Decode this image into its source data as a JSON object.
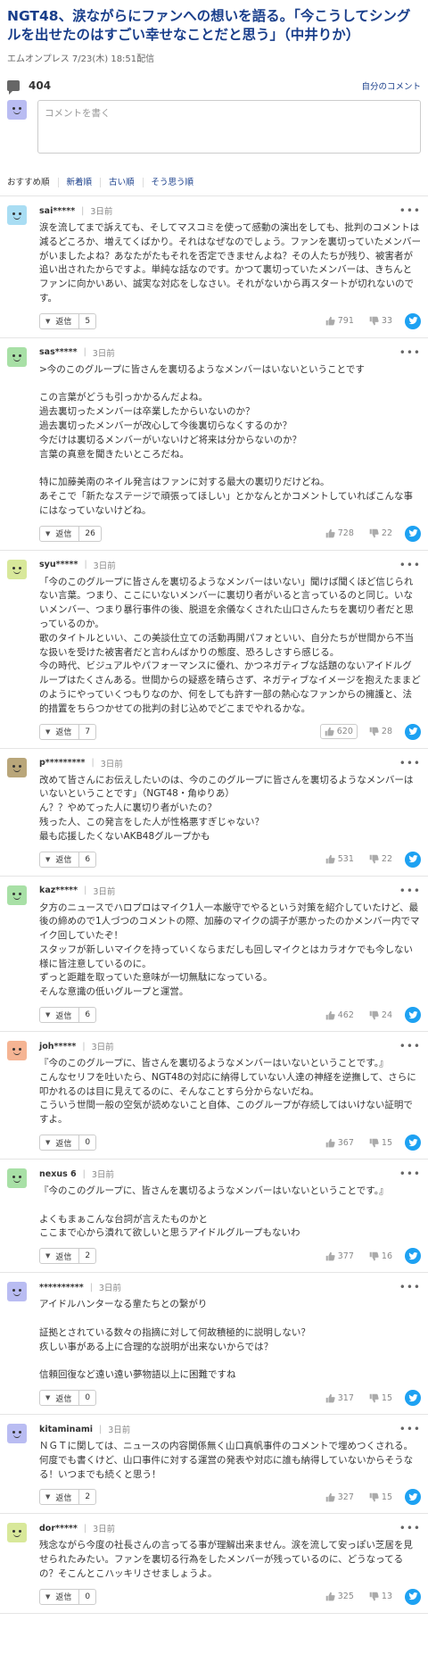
{
  "article": {
    "title": "NGT48、涙ながらにファンへの想いを語る。「今こうしてシングルを出せたのはすごい幸せなことだと思う」（中井りか）",
    "source": "エムオンプレス",
    "date": "7/23(木) 18:51配信"
  },
  "comments_header": {
    "count": "404",
    "own_comments": "自分のコメント",
    "icon": "speech-bubble-icon"
  },
  "comment_input": {
    "placeholder": "コメントを書く"
  },
  "sort_tabs": [
    "おすすめ順",
    "新着順",
    "古い順",
    "そう思う順"
  ],
  "reply_label": "返信",
  "comments": [
    {
      "user": "sai*****",
      "time": "3日前",
      "avatar_color": "#a9ddf3",
      "lines": [
        "涙を流してまで訴えても、そしてマスコミを使って感動の演出をしても、批判のコメントは減るどころか、増えてくばかり。それはなぜなのでしょう。ファンを裏切っていたメンバーがいましたよね？あなたがたもそれを否定できませんよね？その人たちが残り、被害者が追い出されたからですよ。単純な話なのです。かつて裏切っていたメンバーは、きちんとファンに向かいあい、誠実な対応をしなさい。それがないから再スタートが切れないのです。"
      ],
      "replies": "5",
      "up": "791",
      "down": "33",
      "voted": false
    },
    {
      "user": "sas*****",
      "time": "3日前",
      "avatar_color": "#a8e0a6",
      "lines": [
        ">今のこのグループに皆さんを裏切るようなメンバーはいないということです",
        "",
        "この言葉がどうも引っかかるんだよね。",
        "過去裏切ったメンバーは卒業したからいないのか？",
        "過去裏切ったメンバーが改心して今後裏切らなくするのか？",
        "今だけは裏切るメンバーがいないけど将来は分からないのか？",
        "言葉の真意を聞きたいところだね。",
        "",
        "特に加藤美南のネイル発言はファンに対する最大の裏切りだけどね。",
        "あそこで「新たなステージで頑張ってほしい」とかなんとかコメントしていればこんな事にはなっていないけどね。"
      ],
      "replies": "26",
      "up": "728",
      "down": "22",
      "voted": false
    },
    {
      "user": "syu*****",
      "time": "3日前",
      "avatar_color": "#d8e89a",
      "lines": [
        "「今のこのグループに皆さんを裏切るようなメンバーはいない」聞けば聞くほど信じられない言葉。つまり、ここにいないメンバーに裏切り者がいると言っているのと同じ。いないメンバー、つまり暴行事件の後、脱退を余儀なくされた山口さんたちを裏切り者だと思っているのか。",
        "歌のタイトルといい、この美談仕立ての活動再開パフォといい、自分たちが世間から不当な扱いを受けた被害者だと言わんばかりの態度、恐ろしさすら感じる。",
        "今の時代、ビジュアルやパフォーマンスに優れ、かつネガティブな話題のないアイドルグループはたくさんある。世間からの疑惑を晴らさず、ネガティブなイメージを抱えたままどのようにやっていくつもりなのか、何をしても許す一部の熱心なファンからの擁護と、法的措置をちらつかせての批判の封じ込めでどこまでやれるかな。"
      ],
      "replies": "7",
      "up": "620",
      "down": "28",
      "voted": true
    },
    {
      "user": "p*********",
      "time": "3日前",
      "avatar_color": "#b9a67a",
      "lines": [
        "改めて皆さんにお伝えしたいのは、今のこのグループに皆さんを裏切るようなメンバーはいないということです」（NGT48・角ゆりあ）",
        "ん？？やめてった人に裏切り者がいたの？",
        "残った人、この発言をした人が性格悪すぎじゃない？",
        "最も応援したくないAKB48グループかも"
      ],
      "replies": "6",
      "up": "531",
      "down": "22",
      "voted": false
    },
    {
      "user": "kaz*****",
      "time": "3日前",
      "avatar_color": "#a8e0a6",
      "lines": [
        "夕方のニュースでハロプロはマイク1人一本厳守でやるという対策を紹介していたけど、最後の締めので1人づつのコメントの際、加藤のマイクの調子が悪かったのかメンバー内でマイク回していたぞ！",
        "スタッフが新しいマイクを持っていくならまだしも回しマイクとはカラオケでも今しない様に皆注意しているのに。",
        "ずっと距離を取っていた意味が一切無駄になっている。",
        "そんな意識の低いグループと運営。"
      ],
      "replies": "6",
      "up": "462",
      "down": "24",
      "voted": false
    },
    {
      "user": "joh*****",
      "time": "3日前",
      "avatar_color": "#f5b493",
      "lines": [
        "『今のこのグループに、皆さんを裏切るようなメンバーはいないということです。』",
        "こんなセリフを吐いたら、NGT48の対応に納得していない人達の神経を逆撫して、さらに叩かれるのは目に見えてるのに、そんなことすら分からないだね。",
        "こういう世間一般の空気が読めないこと自体、このグループが存続してはいけない証明ですよ。"
      ],
      "replies": "0",
      "up": "367",
      "down": "15",
      "voted": false
    },
    {
      "user": "nexus 6",
      "time": "3日前",
      "avatar_color": "#a8e0a6",
      "lines": [
        "『今のこのグループに、皆さんを裏切るようなメンバーはいないということです。』",
        "",
        "よくもまぁこんな台詞が言えたものかと",
        "ここまで心から潰れて欲しいと思うアイドルグループもないわ"
      ],
      "replies": "2",
      "up": "377",
      "down": "16",
      "voted": false
    },
    {
      "user": "**********",
      "time": "3日前",
      "avatar_color": "#b9bcf2",
      "lines": [
        "アイドルハンターなる輩たちとの繋がり",
        "",
        "証拠とされている数々の指摘に対して何故積極的に説明しない？",
        "疚しい事がある上に合理的な説明が出来ないからでは？",
        "",
        "信頼回復など遠い遠い夢物語以上に困難ですね"
      ],
      "replies": "0",
      "up": "317",
      "down": "15",
      "voted": false
    },
    {
      "user": "kitaminami",
      "time": "3日前",
      "avatar_color": "#b9bcf2",
      "lines": [
        "ＮＧＴに関しては、ニュースの内容関係無く山口真帆事件のコメントで埋めつくされる。何度でも書くけど、山口事件に対する運営の発表や対応に誰も納得していないからそうなる！いつまでも続くと思う！"
      ],
      "replies": "2",
      "up": "327",
      "down": "15",
      "voted": false
    },
    {
      "user": "dor*****",
      "time": "3日前",
      "avatar_color": "#d8e89a",
      "lines": [
        "残念ながら今度の社長さんの言ってる事が理解出来ません。涙を流して安っぽい芝居を見せられたみたい。ファンを裏切る行為をしたメンバーが残っているのに、どうなってるの？そこんとこハッキリさせましょうよ。"
      ],
      "replies": "0",
      "up": "325",
      "down": "13",
      "voted": false
    }
  ]
}
